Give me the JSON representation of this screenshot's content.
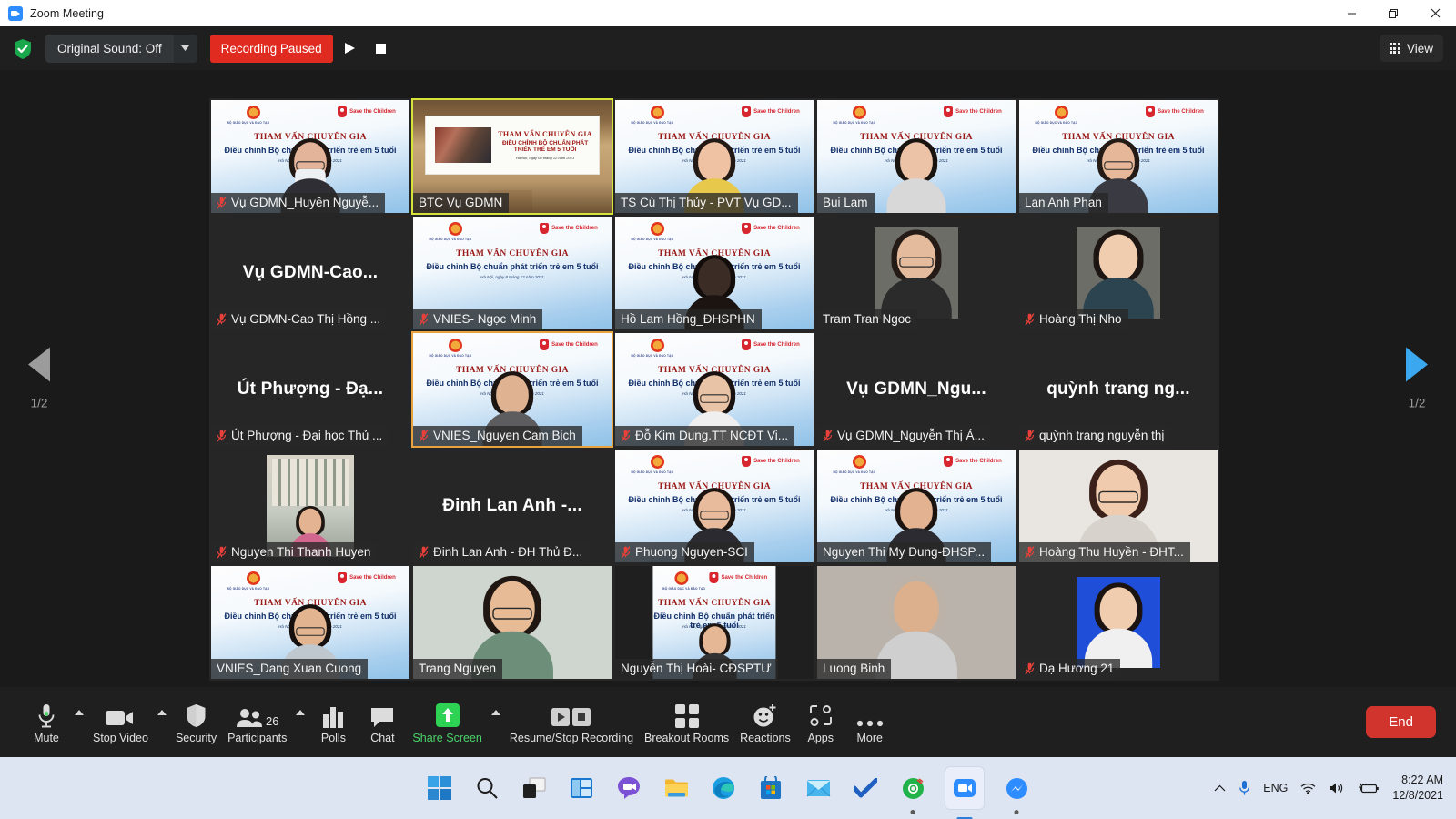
{
  "window": {
    "title": "Zoom Meeting",
    "app_icon": "zoom-icon",
    "minimize": "minimize-icon",
    "maximize": "restore-icon",
    "close": "close-icon"
  },
  "topbar": {
    "security_shield": "shield-check-icon",
    "original_sound_label": "Original Sound: Off",
    "original_sound_caret": "chevron-down-icon",
    "recording_status": "Recording Paused",
    "resume_icon": "play-icon",
    "stop_icon": "stop-icon",
    "view_label": "View",
    "view_icon": "grid-icon"
  },
  "gallery": {
    "prev_page": "1/2",
    "next_page": "1/2",
    "prev_icon": "chevron-left-icon",
    "next_icon": "chevron-right-icon",
    "banner": {
      "org_left": "BỘ GIÁO DỤC VÀ ĐÀO TẠO",
      "org_right": "Save the Children",
      "line1": "THAM VẤN CHUYÊN GIA",
      "line2": "Điều chỉnh Bộ chuẩn phát triển trẻ em 5 tuổi",
      "line3": "Hà Nội, ngày 8 tháng 12 năm 2021"
    },
    "stage_banner": {
      "line1": "THAM VẤN CHUYÊN GIA",
      "line2": "ĐIỀU CHỈNH BỘ CHUẨN PHÁT TRIỂN TRẺ EM 5 TUỔI",
      "line3": "Hà Nội, ngày 08 tháng 12 năm 2021"
    },
    "participants": [
      {
        "name": "Vụ GDMN_Huyền Nguyễ...",
        "muted": true,
        "kind": "banner-person",
        "border": "none",
        "skin": "#e3b49a",
        "hair": "#201713",
        "shirt": "#2e2e34",
        "glasses": true,
        "mask": true
      },
      {
        "name": "BTC Vụ GDMN",
        "muted": false,
        "kind": "room",
        "border": "selected"
      },
      {
        "name": "TS Cù Thị Thủy - PVT Vụ GD...",
        "muted": false,
        "kind": "banner-person",
        "border": "none",
        "skin": "#efc2a4",
        "hair": "#241a15",
        "shirt": "#e8c84a",
        "glasses": false
      },
      {
        "name": "Bui Lam",
        "muted": false,
        "kind": "banner-person",
        "border": "none",
        "skin": "#ecc3a6",
        "hair": "#1a1411",
        "shirt": "#d8d8d8",
        "glasses": false
      },
      {
        "name": "Lan Anh Phan",
        "muted": false,
        "kind": "banner-person",
        "border": "none",
        "skin": "#e6b899",
        "hair": "#241a16",
        "shirt": "#3a3a42",
        "glasses": true
      },
      {
        "name": "Vụ GDMN-Cao Thị Hồng ...",
        "muted": true,
        "kind": "bigname",
        "display": "Vụ  GDMN-Cao...",
        "border": "none"
      },
      {
        "name": "VNIES- Ngọc Minh",
        "muted": true,
        "kind": "banner-only",
        "border": "none"
      },
      {
        "name": "Hồ Lam Hồng_ĐHSPHN",
        "muted": false,
        "kind": "banner-person",
        "border": "none",
        "skin": "#3b2d26",
        "hair": "#120d0b",
        "shirt": "#1b1410",
        "glasses": false
      },
      {
        "name": "Tram Tran Ngoc",
        "muted": false,
        "kind": "photo",
        "border": "none",
        "skin": "#e4bb9c",
        "hair": "#241b17",
        "shirt": "#2b2b2b",
        "glasses": true
      },
      {
        "name": "Hoàng Thị Nho",
        "muted": true,
        "kind": "photo",
        "border": "none",
        "skin": "#f0cdaf",
        "hair": "#1d1512",
        "shirt": "#2c4450",
        "glasses": false
      },
      {
        "name": "Út Phượng - Đại học Thủ ...",
        "muted": true,
        "kind": "bigname",
        "display": "Út Phượng - Đạ...",
        "border": "none"
      },
      {
        "name": "VNIES_Nguyen Cam Bich",
        "muted": true,
        "kind": "banner-person",
        "border": "speaking",
        "skin": "#dfb291",
        "hair": "#1d1512",
        "shirt": "#5d5d60",
        "glasses": false
      },
      {
        "name": "Đỗ Kim Dung.TT NCĐT Vi...",
        "muted": true,
        "kind": "banner-person",
        "border": "none",
        "skin": "#e9c3a5",
        "hair": "#191210",
        "shirt": "#efefef",
        "glasses": true
      },
      {
        "name": "Vụ GDMN_Nguyễn Thị Á...",
        "muted": true,
        "kind": "bigname",
        "display": "Vụ  GDMN_Ngu...",
        "border": "none"
      },
      {
        "name": "quỳnh trang nguyễn thị",
        "muted": true,
        "kind": "bigname",
        "display": "quỳnh trang ng...",
        "border": "none"
      },
      {
        "name": "Nguyen Thi Thanh Huyen",
        "muted": true,
        "kind": "photo-room",
        "border": "none"
      },
      {
        "name": "Đinh Lan Anh - ĐH Thủ Đ...",
        "muted": true,
        "kind": "bigname",
        "display": "Đinh Lan Anh -...",
        "border": "none"
      },
      {
        "name": "Phuong Nguyen-SCI",
        "muted": true,
        "kind": "banner-person",
        "border": "none",
        "skin": "#e7bb9b",
        "hair": "#1b1411",
        "shirt": "#2a2a30",
        "glasses": true
      },
      {
        "name": "Nguyen Thi My Dung-ĐHSP...",
        "muted": false,
        "kind": "banner-person",
        "border": "none",
        "skin": "#e3b291",
        "hair": "#1a1310",
        "shirt": "#2b2b31",
        "glasses": false
      },
      {
        "name": "Hoàng Thu Huyền - ĐHT...",
        "muted": true,
        "kind": "plain-person",
        "border": "none",
        "skin": "#f0cbad",
        "hair": "#3b211a",
        "shirt": "#d8d2cc",
        "glasses": true,
        "bgcolor": "#e9e6e1"
      },
      {
        "name": "VNIES_Dang Xuan Cuong",
        "muted": false,
        "kind": "banner-person",
        "border": "none",
        "skin": "#e2b48f",
        "hair": "#15100d",
        "shirt": "#bfc7cf",
        "glasses": true
      },
      {
        "name": "Trang Nguyen",
        "muted": false,
        "kind": "plain-person",
        "border": "none",
        "skin": "#e6bb95",
        "hair": "#201713",
        "shirt": "#6d8f7a",
        "glasses": true,
        "bgcolor": "#cfd6cf"
      },
      {
        "name": "Nguyễn Thị Hoài- CĐSPTƯ",
        "muted": false,
        "kind": "banner-person-sm",
        "border": "none",
        "skin": "#e5b795",
        "hair": "#1d1512",
        "shirt": "#333"
      },
      {
        "name": "Luong Binh",
        "muted": false,
        "kind": "plain-person",
        "border": "none",
        "skin": "#ddb08d",
        "hair": "#bdb2a8",
        "shirt": "#cfcfcf",
        "glasses": false,
        "bgcolor": "#b9b3ab"
      },
      {
        "name": "Dạ Hương 21",
        "muted": true,
        "kind": "idphoto",
        "border": "none",
        "skin": "#f0cdae",
        "hair": "#1a1310",
        "shirt": "#f0f0f0",
        "bgcolor": "#1f4ed8"
      }
    ]
  },
  "controls": [
    {
      "label": "Mute",
      "icon": "microphone-icon",
      "caret": true,
      "accent": "normal"
    },
    {
      "label": "Stop Video",
      "icon": "video-camera-icon",
      "caret": true,
      "accent": "normal"
    },
    {
      "label": "Security",
      "icon": "shield-icon",
      "caret": false,
      "accent": "normal"
    },
    {
      "label": "Participants",
      "icon": "people-icon",
      "caret": true,
      "accent": "normal",
      "count": "26"
    },
    {
      "label": "Polls",
      "icon": "poll-bars-icon",
      "caret": false,
      "accent": "normal"
    },
    {
      "label": "Chat",
      "icon": "chat-bubble-icon",
      "caret": false,
      "accent": "normal"
    },
    {
      "label": "Share Screen",
      "icon": "share-screen-icon",
      "caret": true,
      "accent": "green"
    },
    {
      "label": "Resume/Stop Recording",
      "icon": "record-controls-icon",
      "caret": false,
      "accent": "normal"
    },
    {
      "label": "Breakout Rooms",
      "icon": "breakout-grid-icon",
      "caret": false,
      "accent": "normal"
    },
    {
      "label": "Reactions",
      "icon": "reactions-smiley-icon",
      "caret": false,
      "accent": "normal"
    },
    {
      "label": "Apps",
      "icon": "apps-icon",
      "caret": false,
      "accent": "normal"
    },
    {
      "label": "More",
      "icon": "ellipsis-icon",
      "caret": false,
      "accent": "normal"
    }
  ],
  "end_button": {
    "label": "End",
    "color": "#d0342c"
  },
  "taskbar": {
    "apps": [
      "windows-start-icon",
      "search-icon",
      "task-view-icon",
      "widgets-icon",
      "teams-chat-icon",
      "file-explorer-icon",
      "edge-browser-icon",
      "microsoft-store-icon",
      "mail-icon",
      "todo-icon",
      "chrome-app-icon",
      "zoom-taskbar-icon",
      "messenger-icon"
    ],
    "tray": {
      "overflow": "chevron-up-icon",
      "microphone": "microphone-tray-icon",
      "language": "ENG",
      "wifi": "wifi-icon",
      "volume": "speaker-icon",
      "battery": "battery-charging-icon",
      "time": "8:22 AM",
      "date": "12/8/2021"
    }
  },
  "colors": {
    "accent_blue": "#2d8cff",
    "recording_red": "#e02b20",
    "end_red": "#d0342c",
    "share_green": "#4ad46a",
    "selected_border": "#d6e43a",
    "speaking_border": "#e8a33d"
  }
}
